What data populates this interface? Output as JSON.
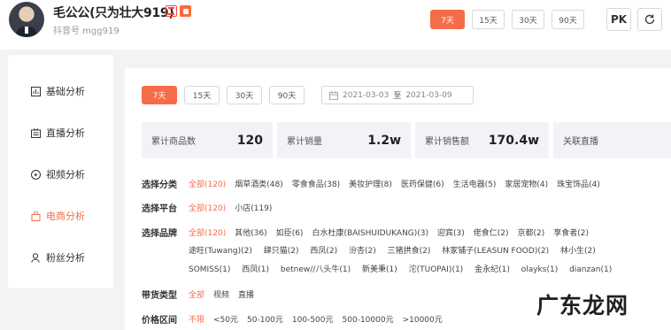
{
  "header": {
    "anchor_name": "毛公公(只为壮大919)",
    "sub_id": "抖音号 mgg919",
    "range_buttons": [
      "7天",
      "15天",
      "30天",
      "90天"
    ],
    "active_range": "7天",
    "pk_label": "PK",
    "badge_icons": [
      "anchor-badge-icon",
      "live-badge-icon"
    ],
    "refresh_icon": "refresh-icon"
  },
  "sidebar": {
    "items": [
      {
        "label": "基础分析",
        "icon": "bar-chart-icon"
      },
      {
        "label": "直播分析",
        "icon": "live-icon"
      },
      {
        "label": "视频分析",
        "icon": "play-icon"
      },
      {
        "label": "电商分析",
        "icon": "shop-icon",
        "active": true
      },
      {
        "label": "粉丝分析",
        "icon": "user-icon"
      }
    ]
  },
  "main": {
    "range_buttons": [
      "7天",
      "15天",
      "30天",
      "90天"
    ],
    "active_range": "7天",
    "date_start": "2021-03-03",
    "date_sep": "至",
    "date_end": "2021-03-09",
    "stats": [
      {
        "label": "累计商品数",
        "value": "120"
      },
      {
        "label": "累计销量",
        "value": "1.2w"
      },
      {
        "label": "累计销售额",
        "value": "170.4w"
      },
      {
        "label": "关联直播",
        "value": ""
      }
    ],
    "filters": {
      "category": {
        "label": "选择分类",
        "options": [
          "全部(120)",
          "烟草酒类(48)",
          "零食食品(38)",
          "美妆护理(8)",
          "医药保健(6)",
          "生活电器(5)",
          "家居宠物(4)",
          "珠宝饰品(4)"
        ]
      },
      "platform": {
        "label": "选择平台",
        "options": [
          "全部(120)",
          "小店(119)"
        ]
      },
      "brand": {
        "label": "选择品牌",
        "line1": [
          "全部(120)",
          "其他(36)",
          "如臣(6)",
          "白水杜康(BAISHUIDUKANG)(3)",
          "迎宾(3)",
          "佬食仁(2)",
          "京都(2)",
          "享食者(2)"
        ],
        "line2": [
          "途旺(Tuwang)(2)",
          "肆只猫(2)",
          "西凤(2)",
          "汾杏(2)",
          "三猪拱食(2)",
          "林家铺子(LEASUN FOOD)(2)",
          "林小生(2)"
        ],
        "line3": [
          "SOMISS(1)",
          "西凤(1)",
          "betnew//八头牛(1)",
          "新美秉(1)",
          "沱(TUOPAI)(1)",
          "金永纪(1)",
          "olayks(1)",
          "dianzan(1)"
        ]
      },
      "type": {
        "label": "带货类型",
        "options": [
          "全部",
          "视频",
          "直播"
        ]
      },
      "price": {
        "label": "价格区间",
        "options": [
          "不限",
          "<50元",
          "50-100元",
          "100-500元",
          "500-10000元",
          ">10000元"
        ]
      }
    }
  },
  "watermark": "广东龙网",
  "colors": {
    "accent": "#f46d48",
    "badge_red": "#f04b3c",
    "stat_bg": "#f1f3f6",
    "page_bg": "#f2f3f5"
  }
}
